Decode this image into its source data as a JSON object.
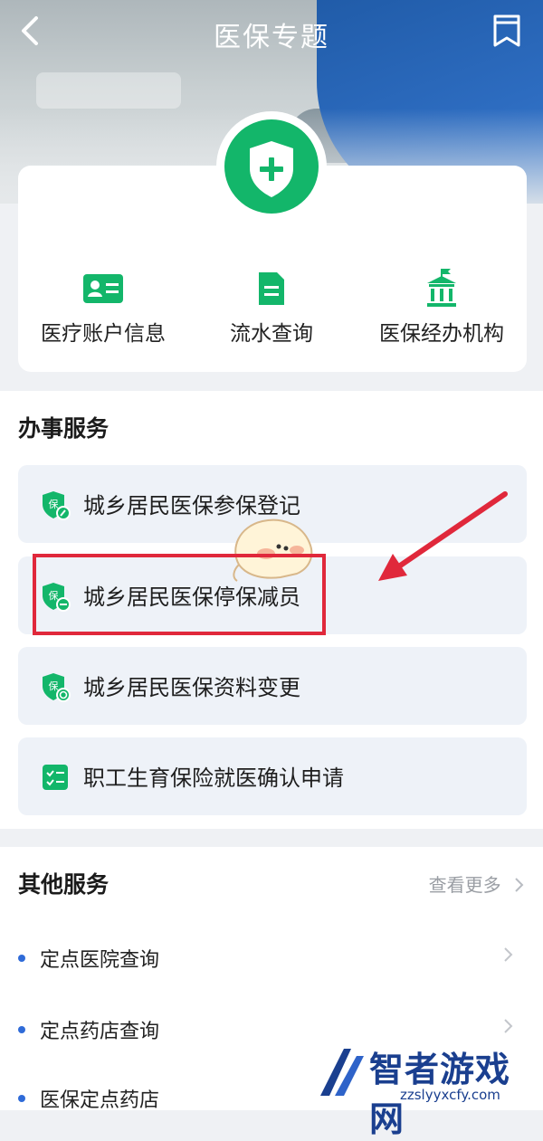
{
  "header": {
    "title": "医保专题"
  },
  "quick_actions": [
    {
      "label": "医疗账户信息",
      "icon": "id-card-icon"
    },
    {
      "label": "流水查询",
      "icon": "receipt-icon"
    },
    {
      "label": "医保经办机构",
      "icon": "building-icon"
    }
  ],
  "services": {
    "title": "办事服务",
    "items": [
      {
        "label": "城乡居民医保参保登记",
        "icon": "shield-edit-icon"
      },
      {
        "label": "城乡居民医保停保减员",
        "icon": "shield-minus-icon"
      },
      {
        "label": "城乡居民医保资料变更",
        "icon": "shield-refresh-icon"
      },
      {
        "label": "职工生育保险就医确认申请",
        "icon": "checklist-icon"
      }
    ]
  },
  "other": {
    "title": "其他服务",
    "more": "查看更多",
    "items": [
      {
        "label": "定点医院查询"
      },
      {
        "label": "定点药店查询"
      },
      {
        "label": "医保定点药店"
      }
    ]
  },
  "watermark": {
    "brand": "智者游戏网",
    "url": "zzslyyxcfy.com"
  },
  "colors": {
    "accent": "#13b66a",
    "highlight": "#e0283b",
    "bullet": "#2f6bd8"
  }
}
